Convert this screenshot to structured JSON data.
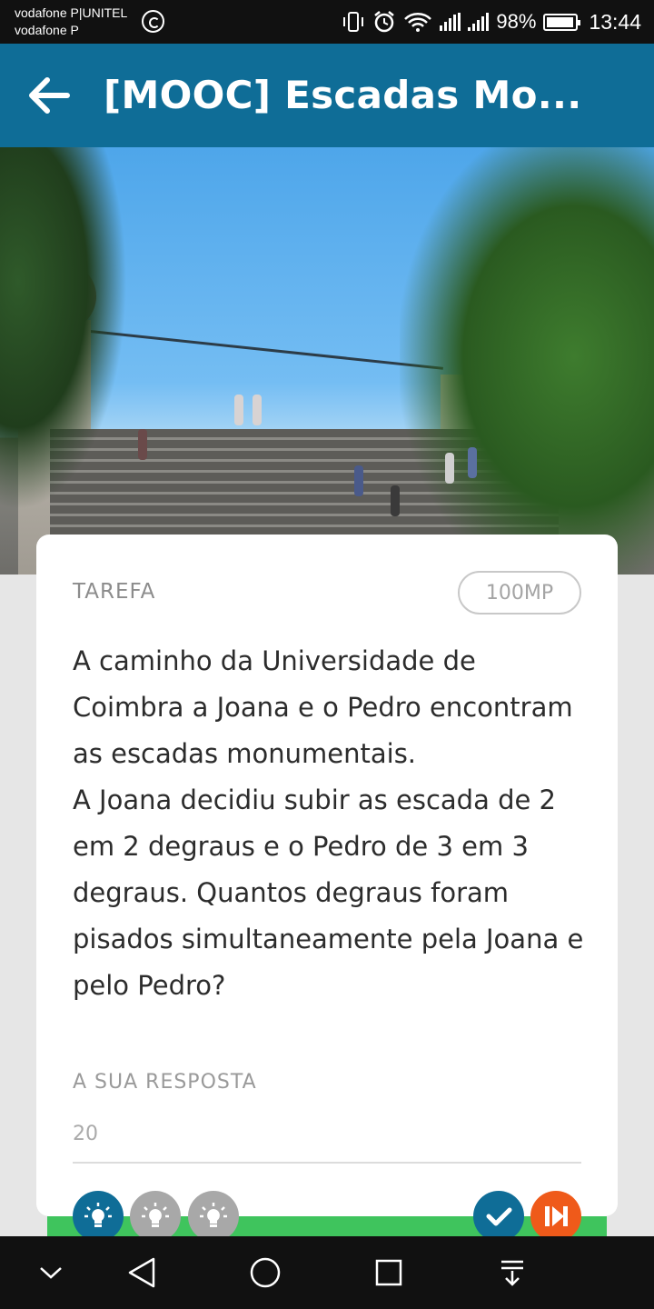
{
  "status_bar": {
    "carrier_1": "vodafone P|UNITEL",
    "carrier_2": "vodafone P",
    "battery_pct": "98%",
    "time": "13:44",
    "icons": [
      "whatsapp-icon",
      "vibrate-icon",
      "alarm-icon",
      "wifi-icon",
      "signal-icon",
      "battery-icon"
    ]
  },
  "app_bar": {
    "title": "[MOOC] Escadas Mo...",
    "back_icon": "arrow-left-icon",
    "color": "#0f6d97"
  },
  "task": {
    "label": "TAREFA",
    "points": "100MP",
    "question": "A caminho da Universidade de Coimbra a Joana e o Pedro encontram as escadas monumentais.\nA Joana decidiu subir as escada de 2 em 2 degraus e o Pedro de 3 em 3 degraus. Quantos degraus foram pisados simultaneamente pela Joana e pelo Pedro?",
    "answer_label": "A SUA RESPOSTA",
    "answer_value": "20"
  },
  "actions": {
    "hints": [
      {
        "icon": "lightbulb-icon",
        "state": "active",
        "color": "#0f6d97"
      },
      {
        "icon": "lightbulb-icon",
        "state": "inactive",
        "color": "#a8a8a8"
      },
      {
        "icon": "lightbulb-icon",
        "state": "inactive",
        "color": "#a8a8a8"
      }
    ],
    "submit_icon": "check-icon",
    "submit_color": "#0f6d97",
    "skip_icon": "skip-next-icon",
    "skip_color": "#ef5a1a",
    "bar_color": "#3fc45d"
  },
  "nav_bar": {
    "icons": [
      "chevron-down-icon",
      "back-triangle-icon",
      "home-circle-icon",
      "recents-square-icon",
      "notification-pull-icon"
    ]
  }
}
